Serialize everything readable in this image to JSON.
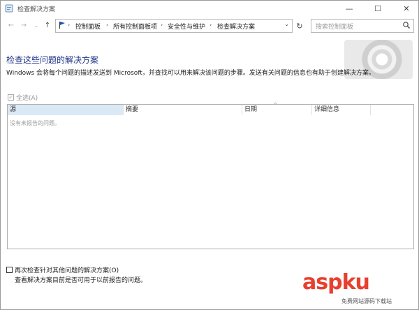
{
  "window": {
    "title": "检查解决方案"
  },
  "nav": {
    "breadcrumb": [
      "控制面板",
      "所有控制面板项",
      "安全性与维护",
      "检查解决方案"
    ],
    "search_placeholder": "搜索控制面板"
  },
  "main": {
    "title": "检查这些问题的解决方案",
    "description": "Windows 会将每个问题的描述发送到 Microsoft，并查找可以用来解决该问题的步骤。发送有关问题的信息也有助于创建解决方案。",
    "select_all_label": "全选(A)",
    "columns": [
      "源",
      "摘要",
      "日期",
      "详细信息"
    ],
    "empty_message": "没有未报告的问题。",
    "recheck_label": "再次检查针对其他问题的解决方案(O)",
    "recheck_desc": "查看解决方案目前是否可用于以前报告的问题。"
  },
  "watermark": {
    "brand": "aspku",
    "sub": "免费网站源码下载站"
  },
  "colors": {
    "title": "#1e3287",
    "sorted_header": "#dbe9f6",
    "watermark": "#e8402f"
  }
}
